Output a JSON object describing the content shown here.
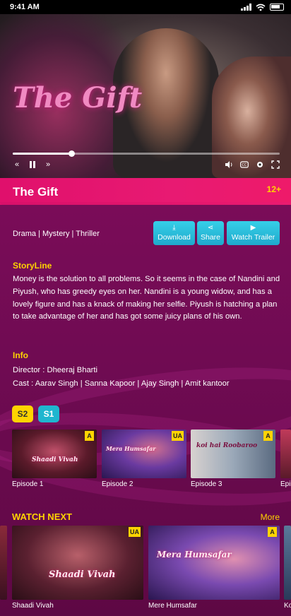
{
  "status_bar": {
    "time": "9:41 AM"
  },
  "player": {
    "logo_text": "The Gift",
    "progress_fraction": 0.22,
    "icons": [
      "rewind-icon",
      "pause-icon",
      "fast-forward-icon",
      "volume-icon",
      "subtitles-icon",
      "settings-icon",
      "fullscreen-icon"
    ]
  },
  "show": {
    "title": "The Gift",
    "rating": "12+",
    "genres": "Drama | Mystery | Thriller"
  },
  "actions": {
    "download": "Download",
    "share": "Share",
    "watch_trailer": "Watch Trailer"
  },
  "storyline": {
    "heading": "StoryLine",
    "text": "Money is the solution to all problems. So it seems in the case of Nandini and Piyush, who has greedy eyes on her. Nandini is a young widow, and has a lovely figure and has a knack of making her selfie. Piyush is hatching a plan to take advantage of her and has got some juicy plans of his own."
  },
  "info": {
    "heading": "Info",
    "director": "Director : Dheeraj Bharti",
    "cast": "Cast : Aarav Singh | Sanna Kapoor | Ajay Singh | Amit kantoor"
  },
  "seasons": [
    {
      "label": "S2",
      "selected": true
    },
    {
      "label": "S1",
      "selected": false
    }
  ],
  "episodes": [
    {
      "title": "Episode 1",
      "badge": "A",
      "art_text": "Shaadi Vivah"
    },
    {
      "title": "Episode 2",
      "badge": "UA",
      "art_text": "Mera Humsafar"
    },
    {
      "title": "Episode 3",
      "badge": "A",
      "art_text": "koi hai Roobaroo"
    },
    {
      "title": "Epi",
      "badge": "",
      "art_text": ""
    }
  ],
  "watch_next": {
    "heading": "WATCH NEXT",
    "more": "More",
    "items": [
      {
        "title": "Shaadi Vivah",
        "badge": "UA",
        "art_text": "Shaadi Vivah"
      },
      {
        "title": "Mere Humsafar",
        "badge": "A",
        "art_text": "Mera Humsafar"
      },
      {
        "title": "Ko",
        "badge": "",
        "art_text": ""
      }
    ]
  },
  "colors": {
    "accent_yellow": "#ffd400",
    "brand_pink": "#e0106c",
    "button_cyan": "#1fa9cc",
    "background_purple": "#6a0a4e"
  }
}
